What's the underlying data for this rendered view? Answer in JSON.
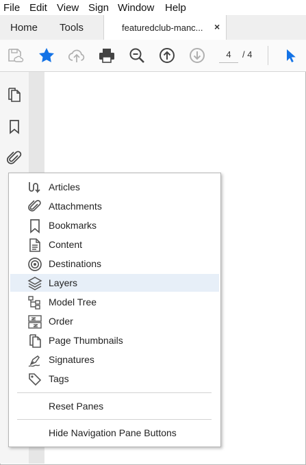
{
  "menubar": {
    "items": [
      "File",
      "Edit",
      "View",
      "Sign",
      "Window",
      "Help"
    ]
  },
  "tabs": {
    "home": "Home",
    "tools": "Tools",
    "document": "featuredclub-manc...",
    "close": "×"
  },
  "toolbar": {
    "page_current": "4",
    "page_total": "/ 4"
  },
  "popup": {
    "items": [
      {
        "label": "Articles",
        "icon": "articles-icon"
      },
      {
        "label": "Attachments",
        "icon": "paperclip-icon"
      },
      {
        "label": "Bookmarks",
        "icon": "bookmark-icon"
      },
      {
        "label": "Content",
        "icon": "content-icon"
      },
      {
        "label": "Destinations",
        "icon": "destinations-icon"
      },
      {
        "label": "Layers",
        "icon": "layers-icon"
      },
      {
        "label": "Model Tree",
        "icon": "model-tree-icon"
      },
      {
        "label": "Order",
        "icon": "order-icon"
      },
      {
        "label": "Page Thumbnails",
        "icon": "page-thumbnails-icon"
      },
      {
        "label": "Signatures",
        "icon": "signatures-icon"
      },
      {
        "label": "Tags",
        "icon": "tags-icon"
      }
    ],
    "reset": "Reset Panes",
    "hide": "Hide Navigation Pane Buttons"
  },
  "colors": {
    "accent": "#1473e6",
    "selected_bg": "#e7eff8"
  }
}
